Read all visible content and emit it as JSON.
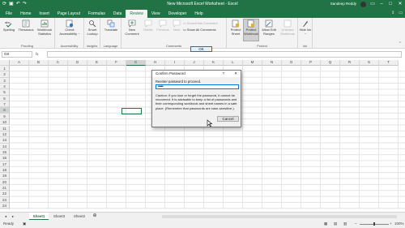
{
  "titlebar": {
    "title": "New Microsoft Excel Worksheet - Excel",
    "user": "Sandeep Reddy",
    "search_icon": "search-icon"
  },
  "tabs": [
    "File",
    "Home",
    "Insert",
    "Page Layout",
    "Formulas",
    "Data",
    "Review",
    "View",
    "Developer",
    "Help"
  ],
  "tabs_right": {
    "share": "",
    "comments": ""
  },
  "ribbon": {
    "proofing": {
      "spelling": "Spelling",
      "thesaurus": "Thesaurus",
      "workbook_statistics": "Workbook Statistics",
      "label": "Proofing"
    },
    "accessibility": {
      "check": "Check Accessibility ~",
      "label": "Accessibility"
    },
    "insights": {
      "smart_lookup": "Smart Lookup",
      "label": "Insights"
    },
    "language": {
      "translate": "Translate",
      "label": "Language"
    },
    "comments": {
      "new_comment": "New Comment",
      "delete": "Delete",
      "previous": "Previous",
      "next": "Next",
      "show_hide": "Show/Hide Comment",
      "show_all": "Show All Comments",
      "label": "Comments"
    },
    "protect": {
      "protect_sheet": "Protect Sheet",
      "protect_workbook": "Protect Workbook",
      "allow_edit": "Allow Edit Ranges",
      "unshare": "Unshare Workbook",
      "label": "Protect"
    },
    "ink": {
      "hide_ink": "Hide Ink ~",
      "label": "Ink"
    }
  },
  "formula": {
    "namebox": "G8",
    "fx": "fx"
  },
  "columns": [
    "A",
    "B",
    "C",
    "D",
    "E",
    "F",
    "G",
    "H",
    "I",
    "J",
    "K",
    "L",
    "M",
    "N",
    "O",
    "P",
    "Q",
    "R",
    "S",
    "T"
  ],
  "rows": [
    "1",
    "2",
    "3",
    "4",
    "5",
    "6",
    "7",
    "8",
    "9",
    "10",
    "11",
    "12",
    "13",
    "14",
    "15",
    "16",
    "17",
    "18",
    "19",
    "20",
    "21",
    "22",
    "23",
    "24",
    "25"
  ],
  "dialog": {
    "title": "Confirm Password",
    "help": "?",
    "close": "✕",
    "prompt": "Reenter password to proceed.",
    "password_mask": "•••••",
    "caution": "Caution: If you lose or forget the password, it cannot be recovered. It is advisable to keep a list of passwords and their corresponding workbook and sheet names in a safe place. (Remember that passwords are case-sensitive.)",
    "ok": "OK",
    "cancel": "Cancel"
  },
  "sheets": [
    "Sheet1",
    "Sheet3",
    "Sheet2"
  ],
  "status": {
    "ready": "Ready",
    "zoom": "100%"
  },
  "colors": {
    "accent": "#217346",
    "dialog_focus": "#0078d7"
  }
}
